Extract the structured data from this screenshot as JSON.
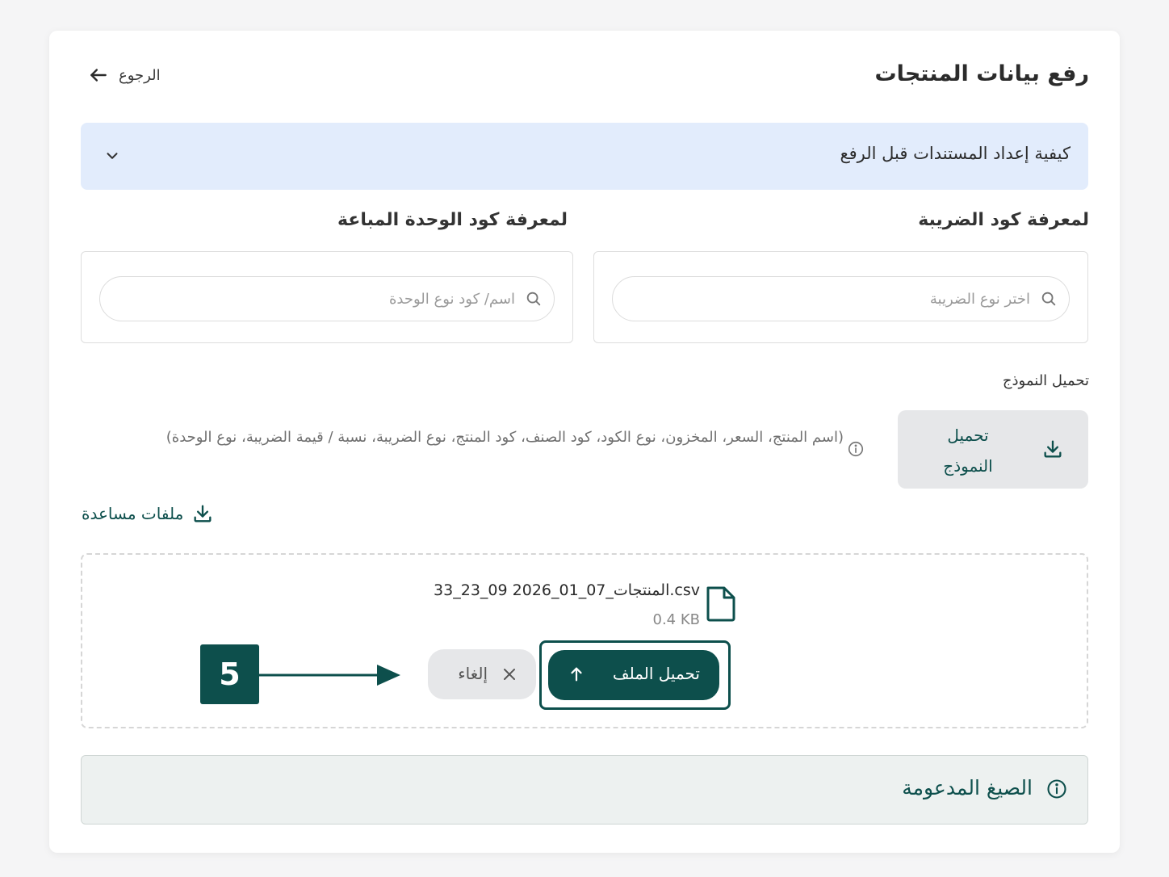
{
  "header": {
    "title": "رفع بيانات المنتجات",
    "back_label": "الرجوع"
  },
  "accordion": {
    "label": "كيفية إعداد المستندات قبل الرفع"
  },
  "tax_code": {
    "label": "لمعرفة كود الضريبة",
    "search_placeholder": "اختر نوع الضريبة"
  },
  "unit_code": {
    "label": "لمعرفة كود الوحدة المباعة",
    "search_placeholder": "اسم/ كود نوع الوحدة"
  },
  "template": {
    "section_title": "تحميل النموذج",
    "button_label": "تحميل النموذج",
    "columns_info": "(اسم المنتج، السعر، المخزون، نوع الكود، كود الصنف، كود المنتج، نوع الضريبة، نسبة / قيمة الضريبة، نوع الوحدة)"
  },
  "help_files": {
    "label": "ملفات مساعدة"
  },
  "upload": {
    "file_name": "المنتجات_07_01_2026 09_23_33.csv",
    "file_size": "0.4 KB",
    "upload_label": "تحميل الملف",
    "cancel_label": "إلغاء"
  },
  "annotation": {
    "step_number": "5"
  },
  "supported_formats": {
    "label": "الصيغ المدعومة"
  },
  "colors": {
    "brand": "#0d4f4c",
    "accordion_bg": "#e2ecfc",
    "button_gray": "#e6e7e9"
  }
}
